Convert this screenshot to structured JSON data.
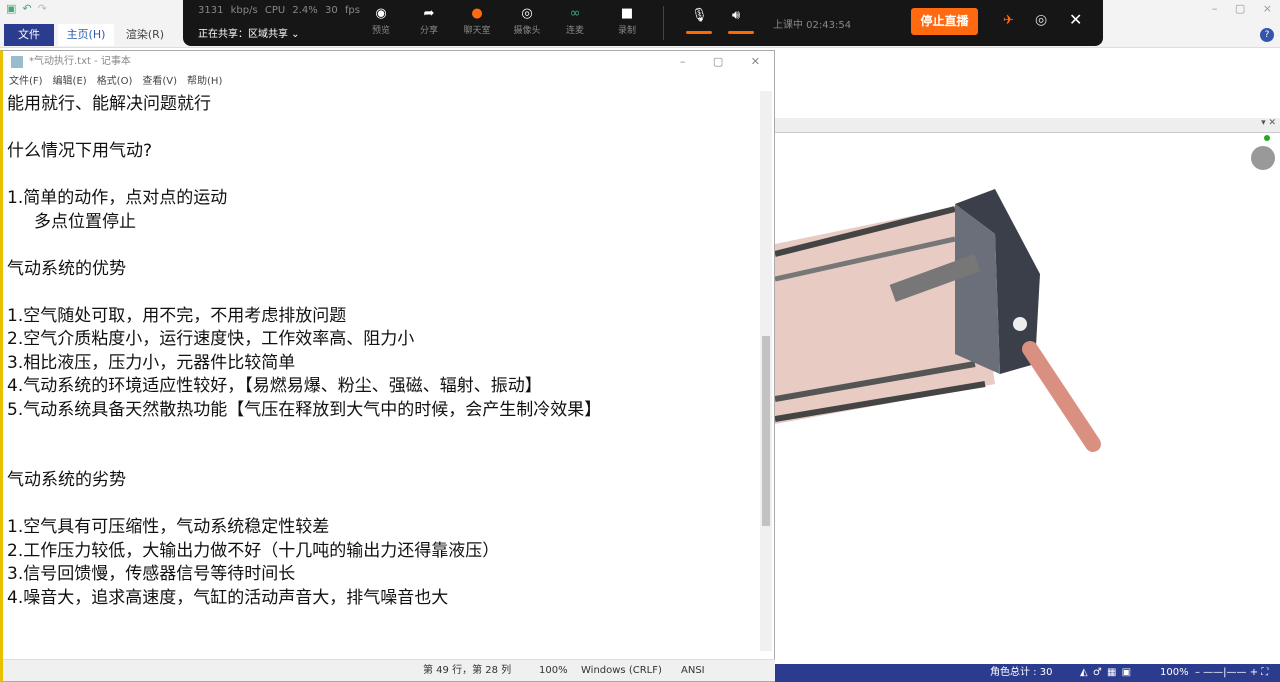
{
  "ribbon": {
    "tabs": [
      "文件",
      "主页(H)",
      "渲染(R)"
    ]
  },
  "live": {
    "stats": "3131 kbp/s   CPU 2.4%   30 fps",
    "sharing": "正在共享：区域共享 ⌄",
    "tools": [
      {
        "icon": "eye-icon",
        "glyph": "◉",
        "label": "预览"
      },
      {
        "icon": "share-icon",
        "glyph": "➦",
        "label": "分享"
      },
      {
        "icon": "chat-icon",
        "glyph": "●",
        "label": "聊天室"
      },
      {
        "icon": "camera-icon",
        "glyph": "◎",
        "label": "摄像头"
      },
      {
        "icon": "link-icon",
        "glyph": "∞",
        "label": "连麦"
      },
      {
        "icon": "record-icon",
        "glyph": "■",
        "label": "录制"
      }
    ],
    "status": "上课中 02:43:54",
    "stop": "停止直播",
    "accent": "#ff6a10"
  },
  "notepad": {
    "title": "*气动执行.txt - 记事本",
    "menu": [
      "文件(F)",
      "编辑(E)",
      "格式(O)",
      "查看(V)",
      "帮助(H)"
    ],
    "lines": [
      "能用就行、能解决问题就行",
      "",
      "什么情况下用气动?",
      "",
      "1.简单的动作，点对点的运动",
      "     多点位置停止",
      "",
      "气动系统的优势",
      "",
      "1.空气随处可取，用不完，不用考虑排放问题",
      "2.空气介质粘度小，运行速度快，工作效率高、阻力小",
      "3.相比液压，压力小，元器件比较简单",
      "4.气动系统的环境适应性较好，【易燃易爆、粉尘、强磁、辐射、振动】",
      "5.气动系统具备天然散热功能【气压在释放到大气中的时候，会产生制冷效果】",
      "",
      "",
      "气动系统的劣势",
      "",
      "1.空气具有可压缩性，气动系统稳定性较差",
      "2.工作压力较低，大输出力做不好（十几吨的输出力还得靠液压）",
      "3.信号回馈慢，传感器信号等待时间长",
      "4.噪音大，追求高速度，气缸的活动声音大，排气噪音也大"
    ],
    "status": {
      "pos": "第 49 行，第 28 列",
      "zoom": "100%",
      "eol": "Windows (CRLF)",
      "enc": "ANSI"
    }
  },
  "cad": {
    "status": {
      "count": "角色总计 : 30",
      "zoom": "100%"
    }
  }
}
